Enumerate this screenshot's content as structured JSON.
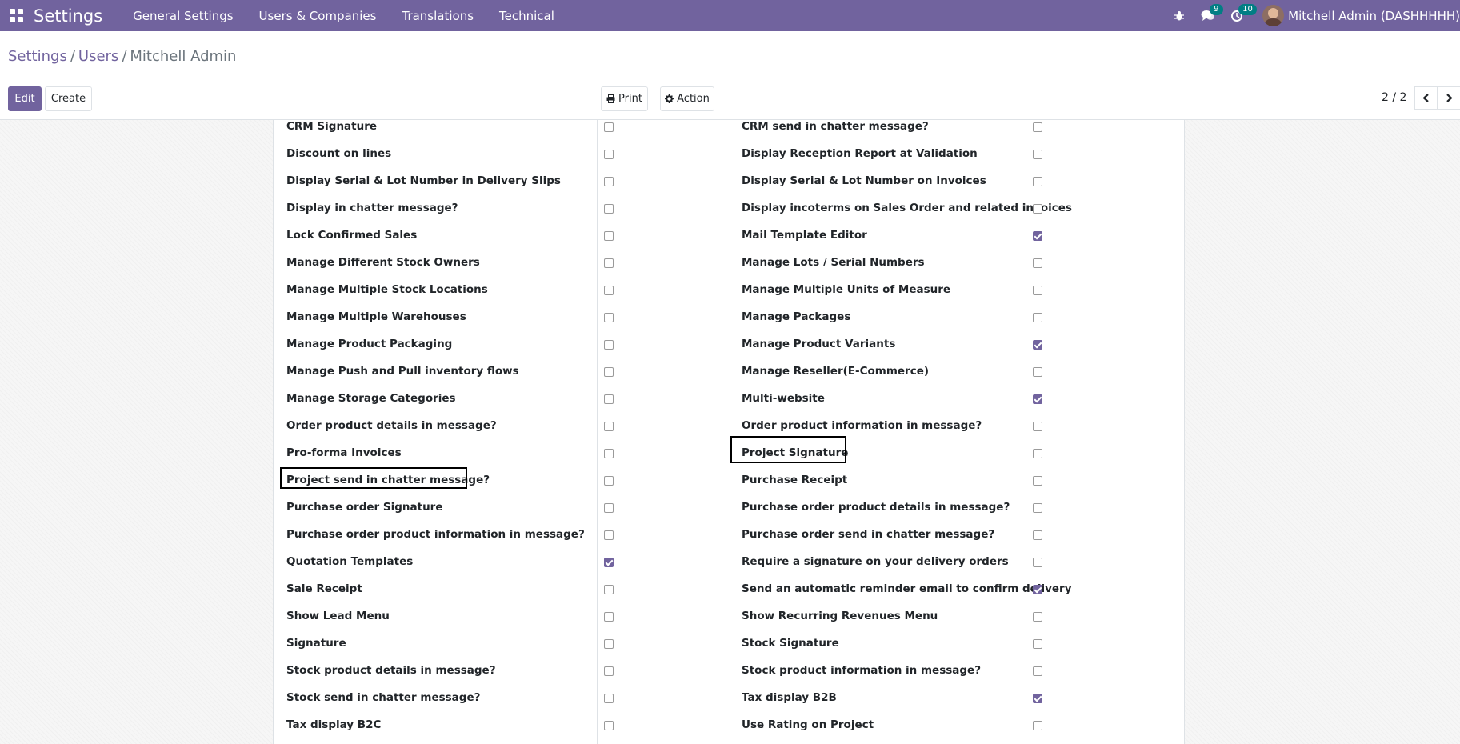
{
  "navbar": {
    "brand": "Settings",
    "menu": [
      "General Settings",
      "Users & Companies",
      "Translations",
      "Technical"
    ],
    "chat_count": "9",
    "activity_count": "10",
    "user_name": "Mitchell Admin (DASHHHHH)"
  },
  "breadcrumb": {
    "root": "Settings",
    "parent": "Users",
    "current": "Mitchell Admin"
  },
  "actions": {
    "edit": "Edit",
    "create": "Create",
    "print": "Print",
    "action": "Action"
  },
  "pager": {
    "text": "2 / 2"
  },
  "rows": [
    {
      "left": "CRM Signature",
      "left_checked": false,
      "right": "CRM send in chatter message?",
      "right_checked": false
    },
    {
      "left": "Discount on lines",
      "left_checked": false,
      "right": "Display Reception Report at Validation",
      "right_checked": false
    },
    {
      "left": "Display Serial & Lot Number in Delivery Slips",
      "left_checked": false,
      "right": "Display Serial & Lot Number on Invoices",
      "right_checked": false
    },
    {
      "left": "Display in chatter message?",
      "left_checked": false,
      "right": "Display incoterms on Sales Order and related invoices",
      "right_checked": false
    },
    {
      "left": "Lock Confirmed Sales",
      "left_checked": false,
      "right": "Mail Template Editor",
      "right_checked": true
    },
    {
      "left": "Manage Different Stock Owners",
      "left_checked": false,
      "right": "Manage Lots / Serial Numbers",
      "right_checked": false
    },
    {
      "left": "Manage Multiple Stock Locations",
      "left_checked": false,
      "right": "Manage Multiple Units of Measure",
      "right_checked": false
    },
    {
      "left": "Manage Multiple Warehouses",
      "left_checked": false,
      "right": "Manage Packages",
      "right_checked": false
    },
    {
      "left": "Manage Product Packaging",
      "left_checked": false,
      "right": "Manage Product Variants",
      "right_checked": true
    },
    {
      "left": "Manage Push and Pull inventory flows",
      "left_checked": false,
      "right": "Manage Reseller(E-Commerce)",
      "right_checked": false
    },
    {
      "left": "Manage Storage Categories",
      "left_checked": false,
      "right": "Multi-website",
      "right_checked": true
    },
    {
      "left": "Order product details in message?",
      "left_checked": false,
      "right": "Order product information in message?",
      "right_checked": false
    },
    {
      "left": "Pro-forma Invoices",
      "left_checked": false,
      "right": "Project Signature",
      "right_checked": false
    },
    {
      "left": "Project send in chatter message?",
      "left_checked": false,
      "right": "Purchase Receipt",
      "right_checked": false
    },
    {
      "left": "Purchase order Signature",
      "left_checked": false,
      "right": "Purchase order product details in message?",
      "right_checked": false
    },
    {
      "left": "Purchase order product information in message?",
      "left_checked": false,
      "right": "Purchase order send in chatter message?",
      "right_checked": false
    },
    {
      "left": "Quotation Templates",
      "left_checked": true,
      "right": "Require a signature on your delivery orders",
      "right_checked": false
    },
    {
      "left": "Sale Receipt",
      "left_checked": false,
      "right": "Send an automatic reminder email to confirm delivery",
      "right_checked": true
    },
    {
      "left": "Show Lead Menu",
      "left_checked": false,
      "right": "Show Recurring Revenues Menu",
      "right_checked": false
    },
    {
      "left": "Signature",
      "left_checked": false,
      "right": "Stock Signature",
      "right_checked": false
    },
    {
      "left": "Stock product details in message?",
      "left_checked": false,
      "right": "Stock product information in message?",
      "right_checked": false
    },
    {
      "left": "Stock send in chatter message?",
      "left_checked": false,
      "right": "Tax display B2B",
      "right_checked": true
    },
    {
      "left": "Tax display B2C",
      "left_checked": false,
      "right": "Use Rating on Project",
      "right_checked": false
    }
  ]
}
